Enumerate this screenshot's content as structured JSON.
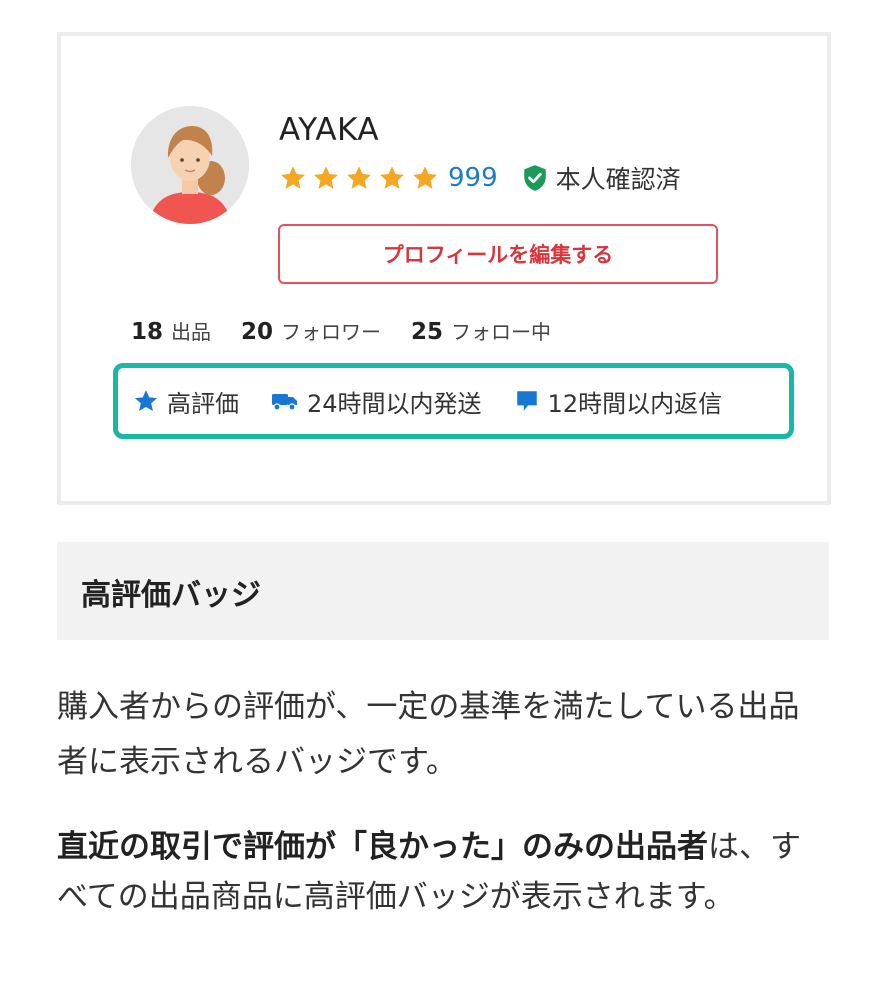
{
  "profile": {
    "username": "AYAKA",
    "rating_stars": 5,
    "rating_count": "999",
    "verified_label": "本人確認済",
    "edit_button_label": "プロフィールを編集する"
  },
  "stats": [
    {
      "number": "18",
      "label": "出品"
    },
    {
      "number": "20",
      "label": "フォロワー"
    },
    {
      "number": "25",
      "label": "フォロー中"
    }
  ],
  "badges": [
    {
      "icon": "star-icon",
      "label": "高評価"
    },
    {
      "icon": "truck-icon",
      "label": "24時間以内発送"
    },
    {
      "icon": "chat-bubble-icon",
      "label": "12時間以内返信"
    }
  ],
  "section": {
    "title": "高評価バッジ"
  },
  "description": {
    "paragraph1": "購入者からの評価が、一定の基準を満たしている出品者に表示されるバッジです。",
    "paragraph2_bold": "直近の取引で評価が「良かった」のみの出品者",
    "paragraph2_rest": "は、すべての出品商品に高評価バッジが表示されます。"
  },
  "colors": {
    "star": "#f5a623",
    "link_blue": "#1e7bc9",
    "verify_green": "#1a9b5a",
    "edit_red": "#d8353c",
    "badge_border": "#18b8a6",
    "badge_icon_blue": "#1877d2"
  }
}
